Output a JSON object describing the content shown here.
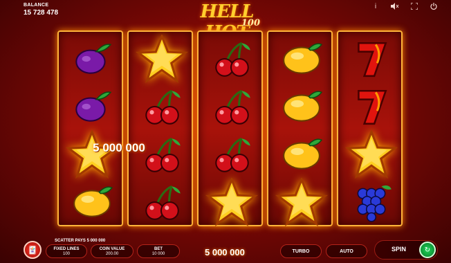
{
  "balance": {
    "label": "BALANCE",
    "value": "15 728 478"
  },
  "top_icons": [
    "info-icon",
    "mute-icon",
    "fullscreen-icon",
    "power-icon"
  ],
  "logo": {
    "main": "HELL HOT",
    "sub": "100"
  },
  "reels": [
    [
      "plum",
      "plum",
      "star",
      "lemon"
    ],
    [
      "star",
      "cherry",
      "cherry",
      "cherry"
    ],
    [
      "cherry",
      "cherry",
      "cherry",
      "star"
    ],
    [
      "lemon",
      "lemon",
      "lemon",
      "star"
    ],
    [
      "seven",
      "seven",
      "star",
      "grapes"
    ]
  ],
  "win_on_reels": "5 000 000",
  "scatter_pays": "SCATTER PAYS 5 000 000",
  "controls": {
    "fixed_lines": {
      "label": "FIXED LINES",
      "value": "100"
    },
    "coin_value": {
      "label": "COIN VALUE",
      "value": "200.00"
    },
    "bet": {
      "label": "BET",
      "value": "10 000"
    },
    "total_win": "5 000 000",
    "turbo": "TURBO",
    "auto": "AUTO",
    "spin": "SPIN"
  },
  "colors": {
    "reel_border": "#ffb43a",
    "background": "#a8120a",
    "spin_icon": "#1fd65a",
    "gamble_icon": "#ff3a2a"
  }
}
